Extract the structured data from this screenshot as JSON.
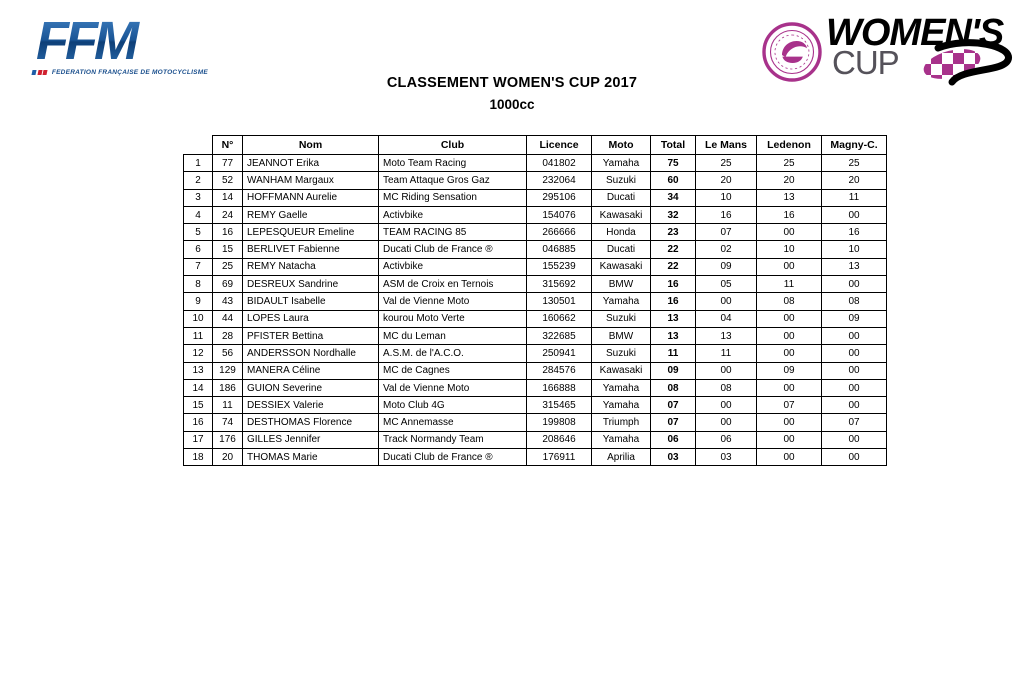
{
  "logos": {
    "ffm": {
      "mark": "FFM",
      "tagline": "FEDERATION FRANÇAISE DE MOTOCYCLISME",
      "colors": {
        "blue": "#1a5596",
        "red": "#d0202f"
      }
    },
    "womens_cup": {
      "word_top": "WOMEN'S",
      "word_bottom": "CUP",
      "badge_text": "FFM WOMEN'S CUP MOTOCYCLISME",
      "colors": {
        "magenta": "#a8328b",
        "black": "#000000",
        "gray": "#55525a"
      }
    }
  },
  "header": {
    "title": "CLASSEMENT WOMEN'S CUP 2017",
    "subtitle": "1000cc"
  },
  "table": {
    "columns": [
      {
        "key": "rank",
        "label": ""
      },
      {
        "key": "num",
        "label": "N°"
      },
      {
        "key": "name",
        "label": "Nom"
      },
      {
        "key": "club",
        "label": "Club"
      },
      {
        "key": "lic",
        "label": "Licence"
      },
      {
        "key": "moto",
        "label": "Moto"
      },
      {
        "key": "total",
        "label": "Total"
      },
      {
        "key": "r1",
        "label": "Le Mans"
      },
      {
        "key": "r2",
        "label": "Ledenon"
      },
      {
        "key": "r3",
        "label": "Magny-C."
      }
    ],
    "rows": [
      {
        "rank": "1",
        "num": "77",
        "name": "JEANNOT Erika",
        "club": "Moto Team Racing",
        "lic": "041802",
        "moto": "Yamaha",
        "total": "75",
        "r1": "25",
        "r2": "25",
        "r3": "25"
      },
      {
        "rank": "2",
        "num": "52",
        "name": "WANHAM Margaux",
        "club": "Team Attaque Gros Gaz",
        "lic": "232064",
        "moto": "Suzuki",
        "total": "60",
        "r1": "20",
        "r2": "20",
        "r3": "20"
      },
      {
        "rank": "3",
        "num": "14",
        "name": "HOFFMANN Aurelie",
        "club": "MC Riding Sensation",
        "lic": "295106",
        "moto": "Ducati",
        "total": "34",
        "r1": "10",
        "r2": "13",
        "r3": "11"
      },
      {
        "rank": "4",
        "num": "24",
        "name": "REMY Gaelle",
        "club": "Activbike",
        "lic": "154076",
        "moto": "Kawasaki",
        "total": "32",
        "r1": "16",
        "r2": "16",
        "r3": "00"
      },
      {
        "rank": "5",
        "num": "16",
        "name": "LEPESQUEUR Emeline",
        "club": "TEAM RACING 85",
        "lic": "266666",
        "moto": "Honda",
        "total": "23",
        "r1": "07",
        "r2": "00",
        "r3": "16"
      },
      {
        "rank": "6",
        "num": "15",
        "name": "BERLIVET Fabienne",
        "club": "Ducati Club de France ®",
        "lic": "046885",
        "moto": "Ducati",
        "total": "22",
        "r1": "02",
        "r2": "10",
        "r3": "10"
      },
      {
        "rank": "7",
        "num": "25",
        "name": "REMY Natacha",
        "club": "Activbike",
        "lic": "155239",
        "moto": "Kawasaki",
        "total": "22",
        "r1": "09",
        "r2": "00",
        "r3": "13"
      },
      {
        "rank": "8",
        "num": "69",
        "name": "DESREUX Sandrine",
        "club": "ASM de Croix en Ternois",
        "lic": "315692",
        "moto": "BMW",
        "total": "16",
        "r1": "05",
        "r2": "11",
        "r3": "00"
      },
      {
        "rank": "9",
        "num": "43",
        "name": "BIDAULT Isabelle",
        "club": "Val de Vienne Moto",
        "lic": "130501",
        "moto": "Yamaha",
        "total": "16",
        "r1": "00",
        "r2": "08",
        "r3": "08"
      },
      {
        "rank": "10",
        "num": "44",
        "name": "LOPES Laura",
        "club": "kourou Moto Verte",
        "lic": "160662",
        "moto": "Suzuki",
        "total": "13",
        "r1": "04",
        "r2": "00",
        "r3": "09"
      },
      {
        "rank": "11",
        "num": "28",
        "name": "PFISTER Bettina",
        "club": "MC du Leman",
        "lic": "322685",
        "moto": "BMW",
        "total": "13",
        "r1": "13",
        "r2": "00",
        "r3": "00"
      },
      {
        "rank": "12",
        "num": "56",
        "name": "ANDERSSON Nordhalle",
        "club": "A.S.M. de l'A.C.O.",
        "lic": "250941",
        "moto": "Suzuki",
        "total": "11",
        "r1": "11",
        "r2": "00",
        "r3": "00"
      },
      {
        "rank": "13",
        "num": "129",
        "name": "MANERA Céline",
        "club": "MC de Cagnes",
        "lic": "284576",
        "moto": "Kawasaki",
        "total": "09",
        "r1": "00",
        "r2": "09",
        "r3": "00"
      },
      {
        "rank": "14",
        "num": "186",
        "name": "GUION Severine",
        "club": "Val de Vienne Moto",
        "lic": "166888",
        "moto": "Yamaha",
        "total": "08",
        "r1": "08",
        "r2": "00",
        "r3": "00"
      },
      {
        "rank": "15",
        "num": "11",
        "name": "DESSIEX Valerie",
        "club": "Moto Club 4G",
        "lic": "315465",
        "moto": "Yamaha",
        "total": "07",
        "r1": "00",
        "r2": "07",
        "r3": "00"
      },
      {
        "rank": "16",
        "num": "74",
        "name": "DESTHOMAS Florence",
        "club": "MC Annemasse",
        "lic": "199808",
        "moto": "Triumph",
        "total": "07",
        "r1": "00",
        "r2": "00",
        "r3": "07"
      },
      {
        "rank": "17",
        "num": "176",
        "name": "GILLES Jennifer",
        "club": "Track Normandy Team",
        "lic": "208646",
        "moto": "Yamaha",
        "total": "06",
        "r1": "06",
        "r2": "00",
        "r3": "00"
      },
      {
        "rank": "18",
        "num": "20",
        "name": "THOMAS Marie",
        "club": "Ducati Club de France ®",
        "lic": "176911",
        "moto": "Aprilia",
        "total": "03",
        "r1": "03",
        "r2": "00",
        "r3": "00"
      }
    ]
  }
}
